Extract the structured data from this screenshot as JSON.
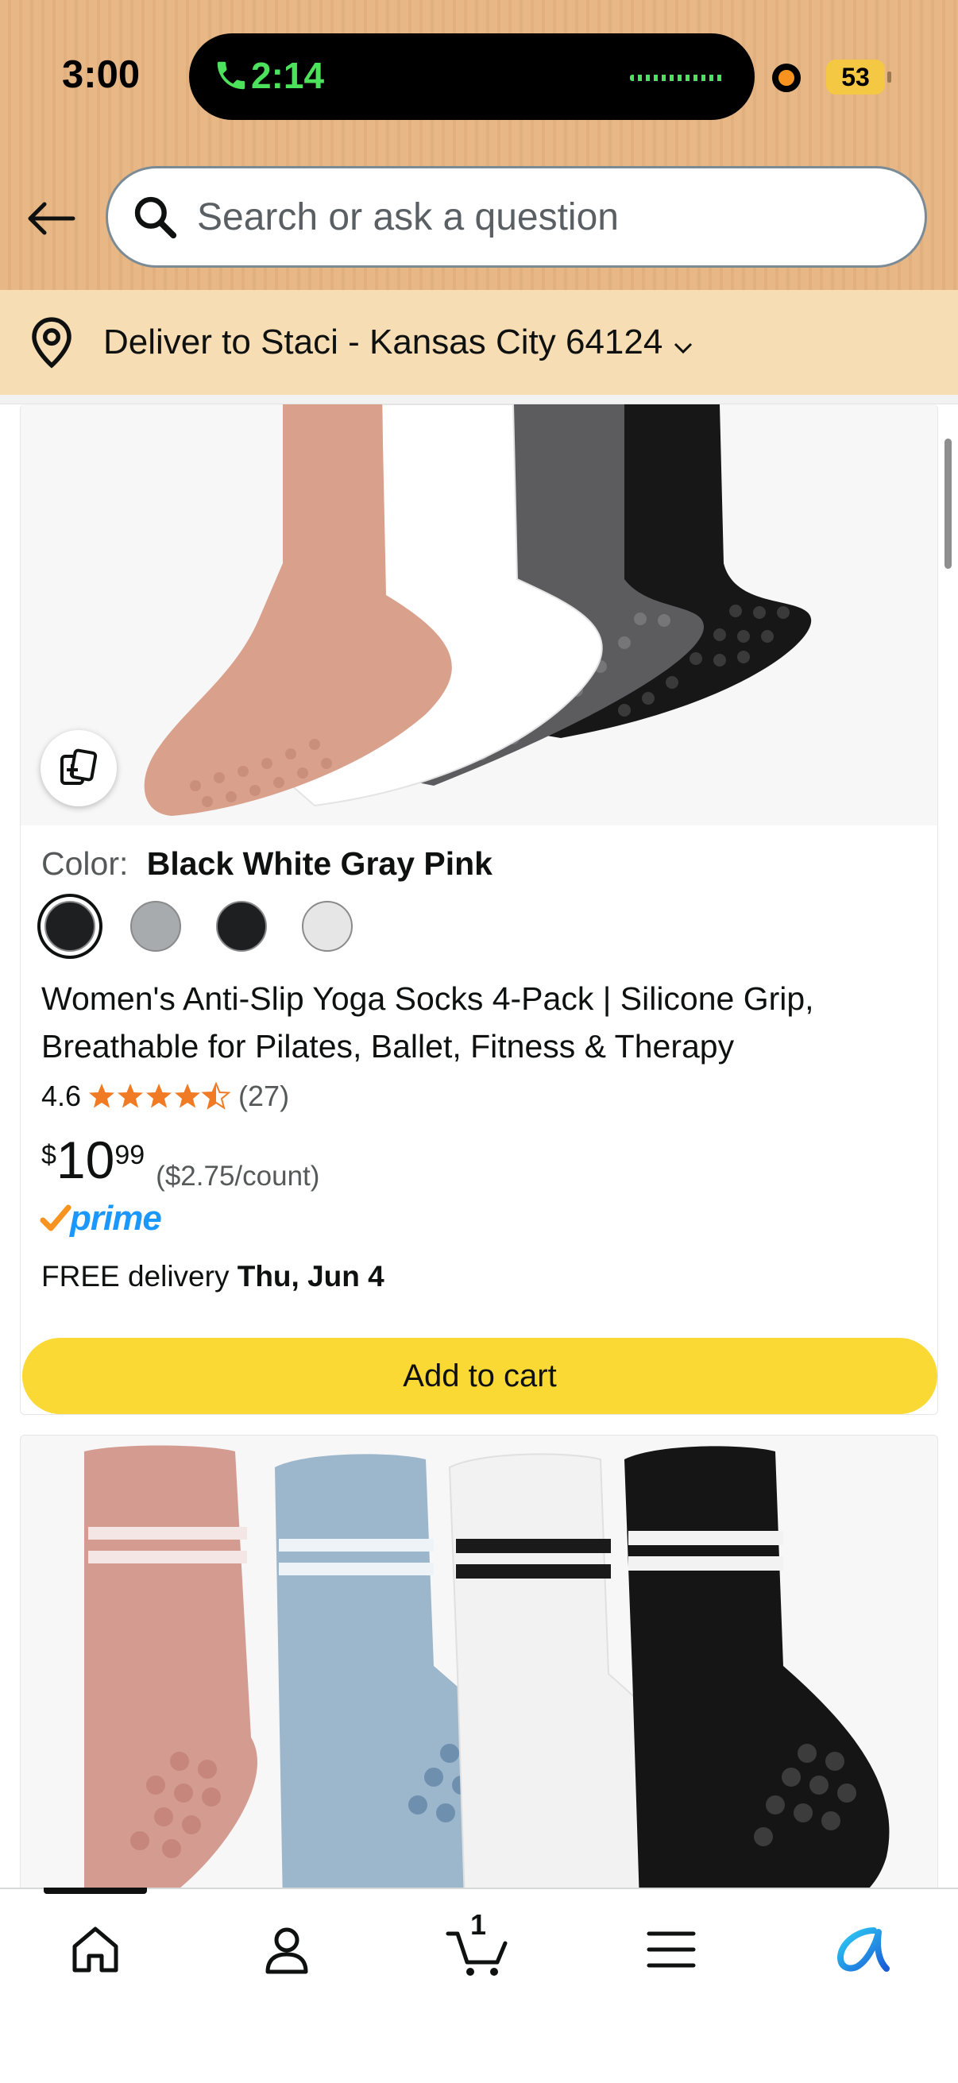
{
  "status_bar": {
    "time": "3:00",
    "call_time": "2:14",
    "battery": "53"
  },
  "header": {
    "search_placeholder": "Search or ask a question"
  },
  "delivery_bar": {
    "text": "Deliver to Staci - Kansas City 64124"
  },
  "product_1": {
    "color_label": "Color:",
    "color_value": "Black White Gray Pink",
    "swatches": [
      "#1e1f21",
      "#a7abae",
      "#1e1f21",
      "#e6e6e6"
    ],
    "selected_swatch": 0,
    "title": "Women's Anti-Slip Yoga Socks 4-Pack | Silicone Grip, Breathable for Pilates, Ballet, Fitness & Therapy",
    "rating": "4.6",
    "stars": 4.5,
    "reviews": "(27)",
    "price_symbol": "$",
    "price_whole": "10",
    "price_fraction": "99",
    "unit_price": "($2.75/count)",
    "prime_label": "prime",
    "delivery_prefix": "FREE delivery",
    "delivery_date": "Thu, Jun 4",
    "add_to_cart": "Add to cart"
  },
  "bottom_nav": {
    "cart_count": "1",
    "items": [
      "home-icon",
      "account-icon",
      "cart-icon",
      "menu-icon",
      "rufus-icon"
    ]
  },
  "colors": {
    "header_bg": "#e7b786",
    "deliver_bg": "#f6ddb4",
    "add_to_cart_bg": "#fad934",
    "star_color": "#f07b24",
    "prime_blue": "#1a98ff",
    "prime_check": "#f7931e"
  }
}
